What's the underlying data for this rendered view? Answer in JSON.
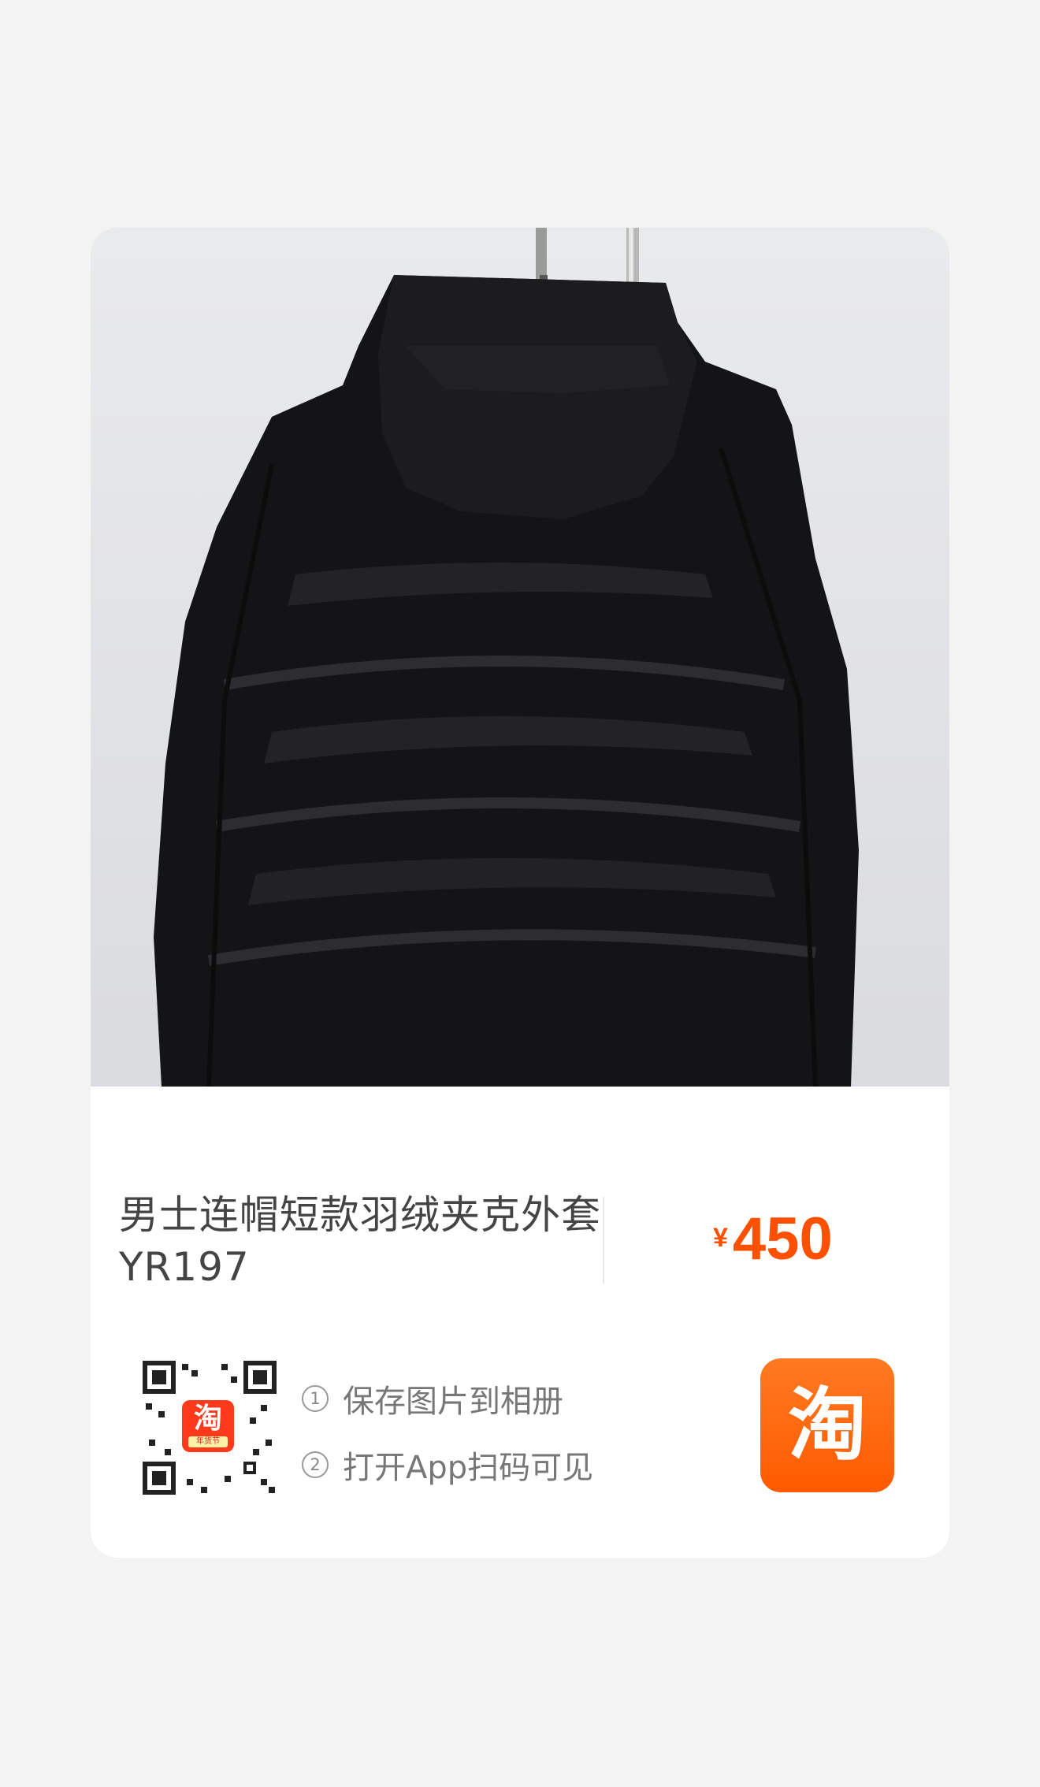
{
  "product": {
    "title_line1": "男士连帽短款羽绒夹克外套",
    "title_line2": "YR197",
    "price_symbol": "¥",
    "price_value": "450"
  },
  "share": {
    "steps": [
      {
        "num": "1",
        "text": "保存图片到相册"
      },
      {
        "num": "2",
        "text": "打开App扫码可见"
      }
    ],
    "qr_logo_glyph": "淘",
    "qr_logo_sub": "年货节",
    "app_icon_glyph": "淘"
  },
  "colors": {
    "price": "#ff5000",
    "app_icon": "#ff5a00",
    "background": "#f3f3f3",
    "card": "#ffffff"
  },
  "icons": [
    "taobao-app-icon",
    "qr-code",
    "jacket-photo"
  ]
}
